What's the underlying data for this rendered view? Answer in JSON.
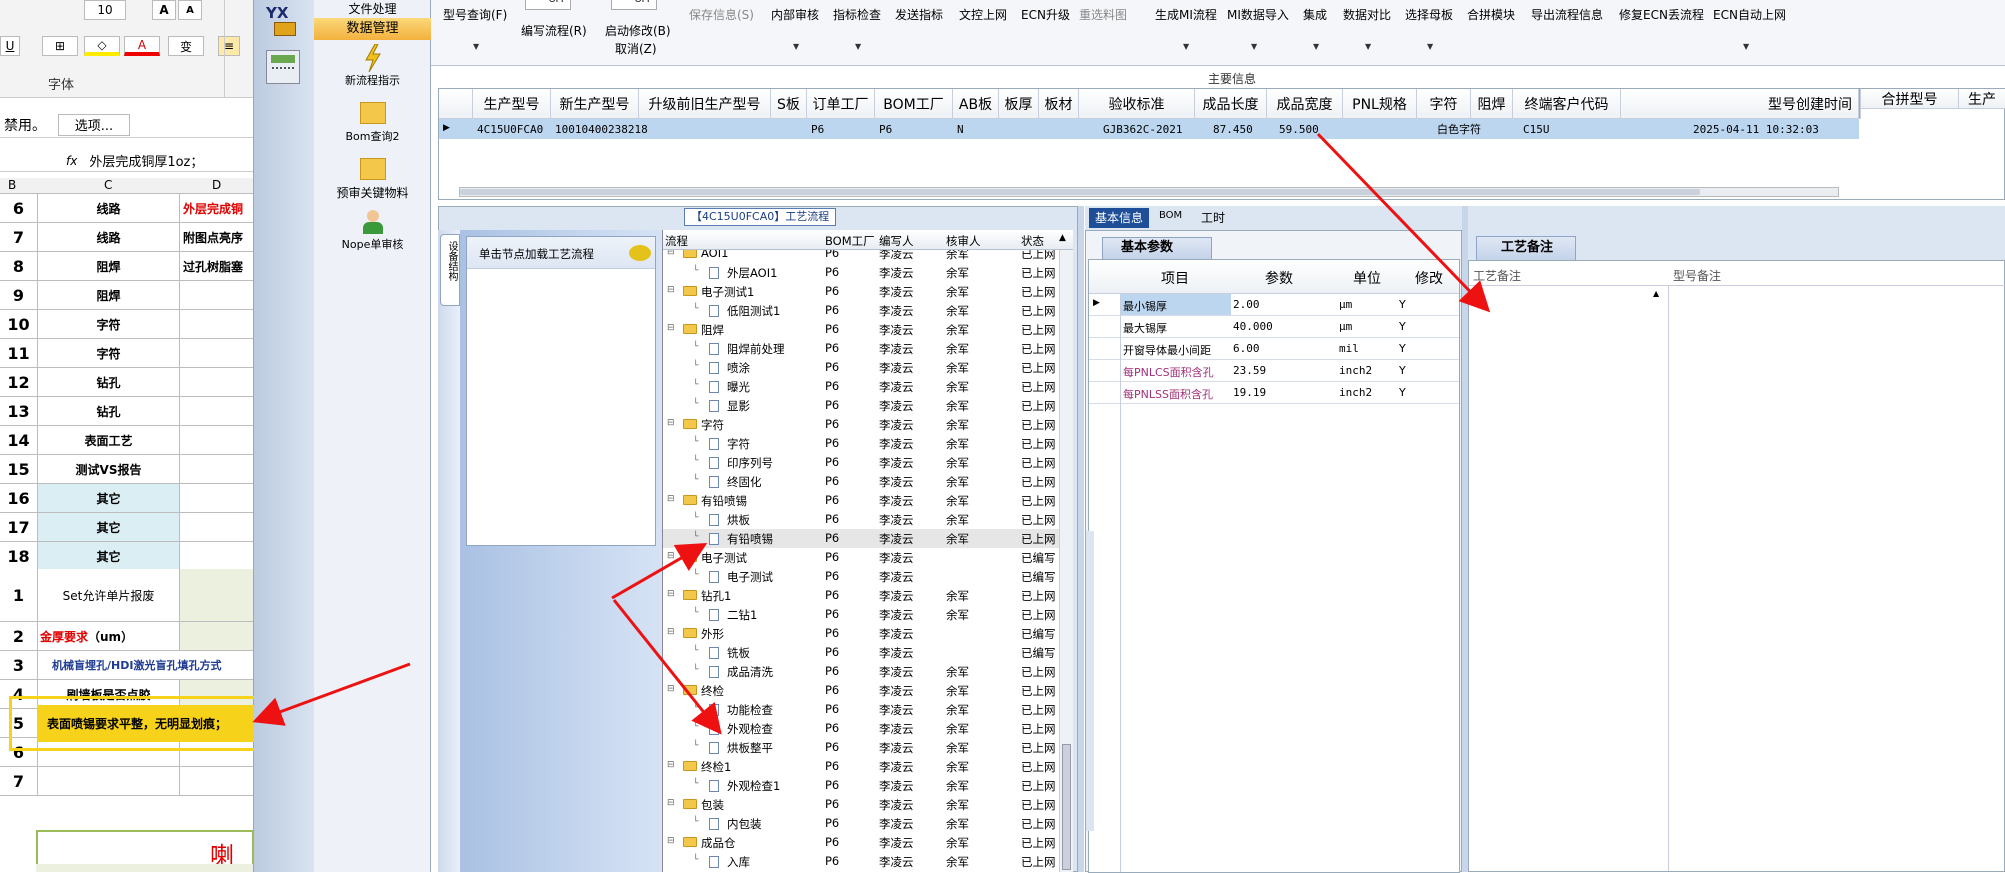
{
  "excel": {
    "font_size": "10",
    "font_group": "字体",
    "disabled_text": "禁用。",
    "options_button": "选项...",
    "formula_fx": "fx",
    "formula": "外层完成铜厚1oz；",
    "cols": [
      "B",
      "C",
      "D"
    ],
    "rows": [
      {
        "n": "6",
        "c": "线路",
        "d": "外层完成铜",
        "dcolor": "#e00000"
      },
      {
        "n": "7",
        "c": "线路",
        "d": "附图点亮序"
      },
      {
        "n": "8",
        "c": "阻焊",
        "d": "过孔树脂塞"
      },
      {
        "n": "9",
        "c": "阻焊",
        "d": ""
      },
      {
        "n": "10",
        "c": "字符",
        "d": ""
      },
      {
        "n": "11",
        "c": "字符",
        "d": ""
      },
      {
        "n": "12",
        "c": "钻孔",
        "d": ""
      },
      {
        "n": "13",
        "c": "钻孔",
        "d": ""
      },
      {
        "n": "14",
        "c": "表面工艺",
        "d": ""
      },
      {
        "n": "15",
        "c": "测试VS报告",
        "d": ""
      },
      {
        "n": "16",
        "c": "其它",
        "d": ""
      },
      {
        "n": "17",
        "c": "其它",
        "d": ""
      },
      {
        "n": "18",
        "c": "其它",
        "d": ""
      }
    ],
    "r1": "Set允许单片报废",
    "r2a": "金厚要求",
    "r2b": "（um）",
    "r3": "机械盲埋孔/HDI激光盲孔填孔方式",
    "r4": "刷墙板是否点胶",
    "r5": "表面喷锡要求平整，无明显划痕；",
    "r6": "6",
    "r7": "7",
    "big_text": "喇叭"
  },
  "nav": {
    "logo": "YX",
    "items": [
      "文件处理",
      "数据管理",
      "新流程指示",
      "Bom查询2",
      "预审关键物料",
      "Nope单审核"
    ]
  },
  "toolbar": {
    "items": [
      "型号查询(F)",
      "OFF",
      "OFF",
      "编写流程(R)",
      "启动修改(B)",
      "取消(Z)",
      "保存信息(S)",
      "内部审核",
      "指标检查",
      "发送指标",
      "文控上网",
      "ECN升级",
      "重选料图",
      "生成MI流程",
      "MI数据导入",
      "集成",
      "数据对比",
      "选择母板",
      "合拼模块",
      "导出流程信息",
      "修复ECN丢流程",
      "ECN自动上网"
    ],
    "section_title": "主要信息"
  },
  "main_grid": {
    "headers": [
      "生产型号",
      "新生产型号",
      "升级前旧生产型号",
      "S板",
      "订单工厂",
      "BOM工厂",
      "AB板",
      "板厚",
      "板材",
      "验收标准",
      "成品长度",
      "成品宽度",
      "PNL规格",
      "字符",
      "阻焊",
      "终端客户代码",
      "型号创建时间"
    ],
    "right_headers": [
      "合拼型号",
      "生产"
    ],
    "row": [
      "4C15U0FCA0",
      "10010400238218",
      "",
      "",
      "P6",
      "P6",
      "N",
      "",
      "",
      "GJB362C-2021",
      "87.450",
      "59.500",
      "",
      "白色字符",
      "",
      "C15U",
      "2025-04-11 10:32:03"
    ]
  },
  "process": {
    "title": "【4C15U0FCA0】工艺流程",
    "side_label": "设备结构",
    "hint": "单击节点加载工艺流程",
    "headers": [
      "流程",
      "BOM工厂",
      "编写人",
      "核审人",
      "状态"
    ],
    "rows": [
      {
        "l": 1,
        "t": "AOI1",
        "f": "P6",
        "w": "李凌云",
        "r": "余军",
        "s": "已上网"
      },
      {
        "l": 2,
        "t": "外层AOI1",
        "f": "P6",
        "w": "李凌云",
        "r": "余军",
        "s": "已上网"
      },
      {
        "l": 1,
        "t": "电子测试1",
        "f": "P6",
        "w": "李凌云",
        "r": "余军",
        "s": "已上网"
      },
      {
        "l": 2,
        "t": "低阻测试1",
        "f": "P6",
        "w": "李凌云",
        "r": "余军",
        "s": "已上网"
      },
      {
        "l": 1,
        "t": "阻焊",
        "f": "P6",
        "w": "李凌云",
        "r": "余军",
        "s": "已上网"
      },
      {
        "l": 2,
        "t": "阻焊前处理",
        "f": "P6",
        "w": "李凌云",
        "r": "余军",
        "s": "已上网"
      },
      {
        "l": 2,
        "t": "喷涂",
        "f": "P6",
        "w": "李凌云",
        "r": "余军",
        "s": "已上网"
      },
      {
        "l": 2,
        "t": "曝光",
        "f": "P6",
        "w": "李凌云",
        "r": "余军",
        "s": "已上网"
      },
      {
        "l": 2,
        "t": "显影",
        "f": "P6",
        "w": "李凌云",
        "r": "余军",
        "s": "已上网"
      },
      {
        "l": 1,
        "t": "字符",
        "f": "P6",
        "w": "李凌云",
        "r": "余军",
        "s": "已上网"
      },
      {
        "l": 2,
        "t": "字符",
        "f": "P6",
        "w": "李凌云",
        "r": "余军",
        "s": "已上网"
      },
      {
        "l": 2,
        "t": "印序列号",
        "f": "P6",
        "w": "李凌云",
        "r": "余军",
        "s": "已上网"
      },
      {
        "l": 2,
        "t": "终固化",
        "f": "P6",
        "w": "李凌云",
        "r": "余军",
        "s": "已上网"
      },
      {
        "l": 1,
        "t": "有铅喷锡",
        "f": "P6",
        "w": "李凌云",
        "r": "余军",
        "s": "已上网"
      },
      {
        "l": 2,
        "t": "烘板",
        "f": "P6",
        "w": "李凌云",
        "r": "余军",
        "s": "已上网"
      },
      {
        "l": 2,
        "t": "有铅喷锡",
        "f": "P6",
        "w": "李凌云",
        "r": "余军",
        "s": "已上网",
        "sel": true
      },
      {
        "l": 1,
        "t": "电子测试",
        "f": "P6",
        "w": "李凌云",
        "r": "",
        "s": "已编写"
      },
      {
        "l": 2,
        "t": "电子测试",
        "f": "P6",
        "w": "李凌云",
        "r": "",
        "s": "已编写"
      },
      {
        "l": 1,
        "t": "钻孔1",
        "f": "P6",
        "w": "李凌云",
        "r": "余军",
        "s": "已上网"
      },
      {
        "l": 2,
        "t": "二钻1",
        "f": "P6",
        "w": "李凌云",
        "r": "余军",
        "s": "已上网"
      },
      {
        "l": 1,
        "t": "外形",
        "f": "P6",
        "w": "李凌云",
        "r": "",
        "s": "已编写"
      },
      {
        "l": 2,
        "t": "铣板",
        "f": "P6",
        "w": "李凌云",
        "r": "",
        "s": "已编写"
      },
      {
        "l": 2,
        "t": "成品清洗",
        "f": "P6",
        "w": "李凌云",
        "r": "余军",
        "s": "已上网"
      },
      {
        "l": 1,
        "t": "终检",
        "f": "P6",
        "w": "李凌云",
        "r": "余军",
        "s": "已上网"
      },
      {
        "l": 2,
        "t": "功能检查",
        "f": "P6",
        "w": "李凌云",
        "r": "余军",
        "s": "已上网"
      },
      {
        "l": 2,
        "t": "外观检查",
        "f": "P6",
        "w": "李凌云",
        "r": "余军",
        "s": "已上网"
      },
      {
        "l": 2,
        "t": "烘板整平",
        "f": "P6",
        "w": "李凌云",
        "r": "余军",
        "s": "已上网"
      },
      {
        "l": 1,
        "t": "终检1",
        "f": "P6",
        "w": "李凌云",
        "r": "余军",
        "s": "已上网"
      },
      {
        "l": 2,
        "t": "外观检查1",
        "f": "P6",
        "w": "李凌云",
        "r": "余军",
        "s": "已上网"
      },
      {
        "l": 1,
        "t": "包装",
        "f": "P6",
        "w": "李凌云",
        "r": "余军",
        "s": "已上网"
      },
      {
        "l": 2,
        "t": "内包装",
        "f": "P6",
        "w": "李凌云",
        "r": "余军",
        "s": "已上网"
      },
      {
        "l": 1,
        "t": "成品仓",
        "f": "P6",
        "w": "李凌云",
        "r": "余军",
        "s": "已上网"
      },
      {
        "l": 2,
        "t": "入库",
        "f": "P6",
        "w": "李凌云",
        "r": "余军",
        "s": "已上网"
      }
    ]
  },
  "tabs": [
    "基本信息",
    "BOM",
    "工时"
  ],
  "basic": {
    "title": "基本参数",
    "headers": [
      "项目",
      "参数",
      "单位",
      "修改"
    ],
    "rows": [
      {
        "a": "最小锡厚",
        "b": "2.00",
        "c": "μm",
        "d": "Y",
        "hl": true
      },
      {
        "a": "最大锡厚",
        "b": "40.000",
        "c": "μm",
        "d": "Y"
      },
      {
        "a": "开窗导体最小间距",
        "b": "6.00",
        "c": "mil",
        "d": "Y"
      },
      {
        "a": "每PNLCS面积含孔",
        "b": "23.59",
        "c": "inch2",
        "d": "Y",
        "pink": true
      },
      {
        "a": "每PNLSS面积含孔",
        "b": "19.19",
        "c": "inch2",
        "d": "Y",
        "pink": true
      }
    ]
  },
  "craft": {
    "title": "工艺备注",
    "col1": "工艺备注",
    "col2": "型号备注"
  },
  "colors": {
    "arrow": "#ee1111",
    "highlight": "#f7d21b",
    "accent": "#1f4e99"
  }
}
